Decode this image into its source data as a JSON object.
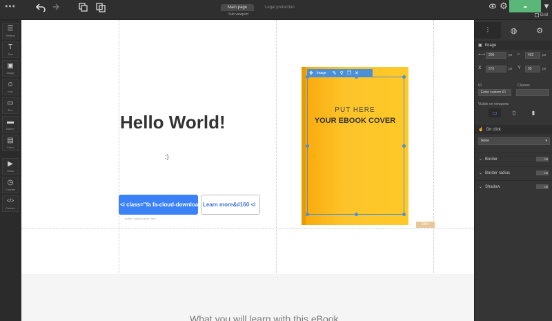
{
  "topbar": {
    "dots": "•••",
    "undo_icon": "undo-icon",
    "redo_icon": "redo-icon",
    "tabs": [
      {
        "label": "Main page",
        "active": true
      },
      {
        "label": "Legal protection",
        "active": false
      }
    ],
    "subtitle": "Sub viewport",
    "grid_label": "Grid"
  },
  "left_toolbar": [
    {
      "glyph": "☰",
      "label": "Section",
      "icon": "sections-icon"
    },
    {
      "glyph": "T",
      "label": "Text",
      "icon": "text-icon"
    },
    {
      "glyph": "▣",
      "label": "Image",
      "icon": "image-icon"
    },
    {
      "glyph": "☺",
      "label": "Icon",
      "icon": "icon-icon"
    },
    {
      "glyph": "▭",
      "label": "Box",
      "icon": "box-icon"
    },
    {
      "glyph": "▬",
      "label": "Button",
      "icon": "button-icon"
    },
    {
      "glyph": "▤",
      "label": "Form",
      "icon": "form-icon"
    },
    {
      "glyph": "▶",
      "label": "Video",
      "icon": "video-icon"
    },
    {
      "glyph": "◷",
      "label": "Counter",
      "icon": "counter-icon"
    },
    {
      "glyph": "</>",
      "label": "Custom",
      "icon": "custom-code-icon"
    }
  ],
  "canvas": {
    "title": "Hello World!",
    "smile": ":)",
    "download_button": "<i class=\"fa fa-cloud-download",
    "learn_button": "Learn more&#160 <i",
    "button_caption": "Button caption goes here",
    "bottom_heading": "What you will learn with this eBook"
  },
  "ebook": {
    "line1": "PUT HERE",
    "line2": "YOUR EBOOK COVER",
    "toolbar_tag": "Image",
    "size_tag": "155×"
  },
  "right_panel": {
    "section_image": "Image",
    "w_label": "Width",
    "w_value": "296",
    "w_unit": "px",
    "h_value": "462",
    "h_unit": "px",
    "x_value": "570",
    "x_unit": "px",
    "y_value": "95",
    "y_unit": "px",
    "id_label": "ID",
    "id_value": "Enter custom ID",
    "classes_label": "Classes",
    "visible_label": "Visible on viewports",
    "section_onclick": "On click",
    "onclick_value": "None",
    "rows": [
      {
        "label": "Border",
        "toggle": "Off"
      },
      {
        "label": "Border radius",
        "toggle": "Off"
      },
      {
        "label": "Shadow",
        "toggle": "Off"
      }
    ]
  },
  "colors": {
    "accent": "#3b82f6",
    "ebook": "#fcc42a",
    "publish": "#5bb67a"
  }
}
